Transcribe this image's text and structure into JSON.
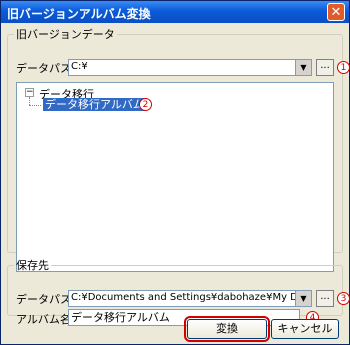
{
  "window": {
    "title": "旧バージョンアルバム変換",
    "close_symbol": "✕"
  },
  "old_group": {
    "legend": "旧バージョンデータ",
    "data_path_label": "データパス:",
    "data_path_value": "C:¥",
    "browse_label": "...",
    "tree": {
      "toggle": "−",
      "root": "データ移行",
      "child": "データ移行アルバム"
    }
  },
  "save_group": {
    "legend": "保存先",
    "data_path_label": "データパス:",
    "data_path_value": "C:¥Documents and Settings¥dabohaze¥My Documents¥",
    "browse_label": "...",
    "album_name_label": "アルバム名:",
    "album_name_value": "データ移行アルバム"
  },
  "buttons": {
    "convert": "変換",
    "cancel": "キャンセル"
  },
  "markers": {
    "one": "1",
    "two": "2",
    "three": "3",
    "four": "4"
  },
  "colors": {
    "marker": "#d40000",
    "selection": "#316ac5",
    "titlebar": "#0b5bd8"
  }
}
